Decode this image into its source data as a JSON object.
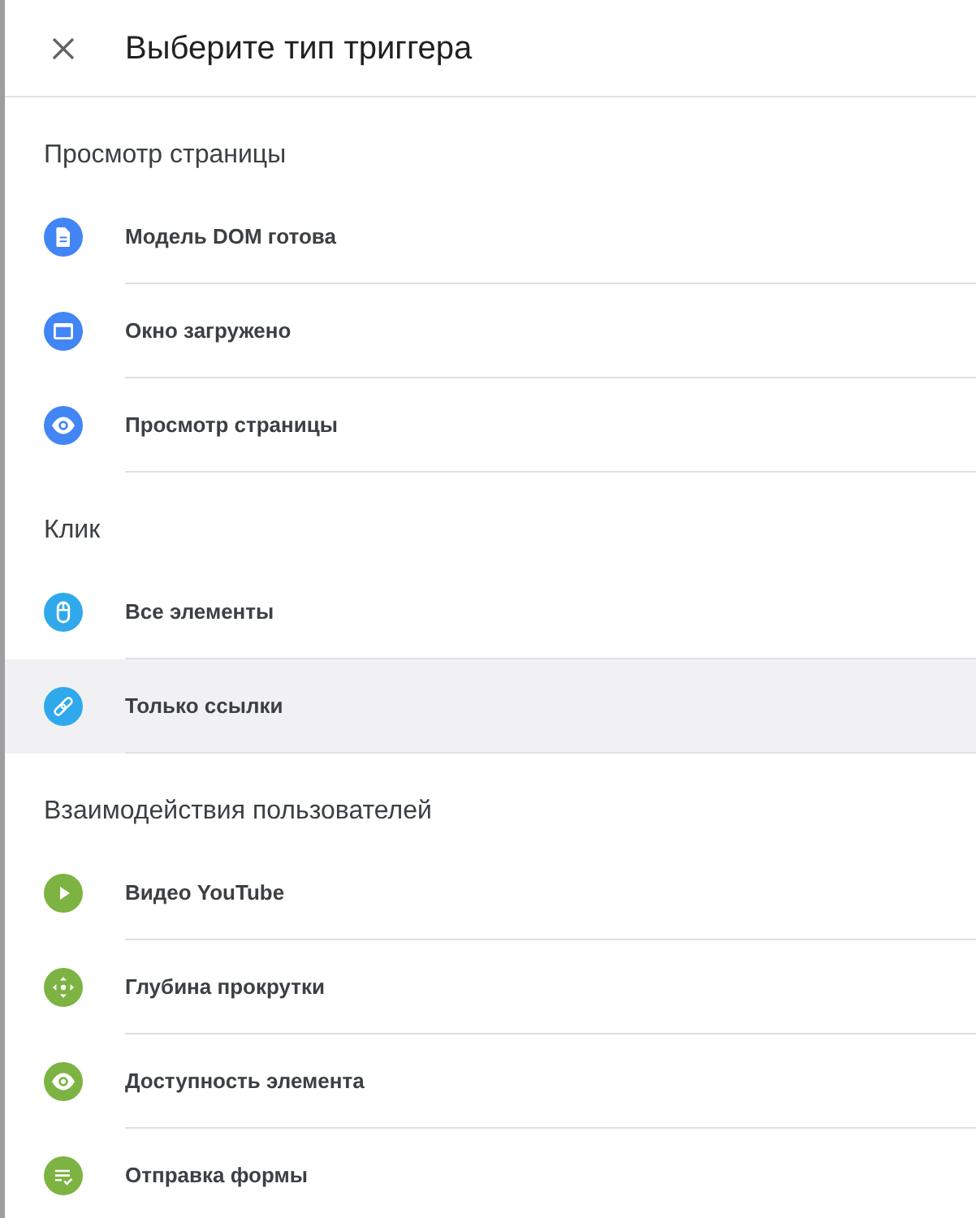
{
  "dialog": {
    "title": "Выберите тип триггера"
  },
  "sections": [
    {
      "heading": "Просмотр страницы",
      "color": "#4285f4",
      "items": [
        {
          "label": "Модель DOM готова",
          "selected": false
        },
        {
          "label": "Окно загружено",
          "selected": false
        },
        {
          "label": "Просмотр страницы",
          "selected": false
        }
      ]
    },
    {
      "heading": "Клик",
      "color": "#2fa9ec",
      "items": [
        {
          "label": "Все элементы",
          "selected": false
        },
        {
          "label": "Только ссылки",
          "selected": true
        }
      ]
    },
    {
      "heading": "Взаимодействия пользователей",
      "color": "#7cb342",
      "items": [
        {
          "label": "Видео YouTube",
          "selected": false
        },
        {
          "label": "Глубина прокрутки",
          "selected": false
        },
        {
          "label": "Доступность элемента",
          "selected": false
        },
        {
          "label": "Отправка формы",
          "selected": false
        }
      ]
    }
  ]
}
